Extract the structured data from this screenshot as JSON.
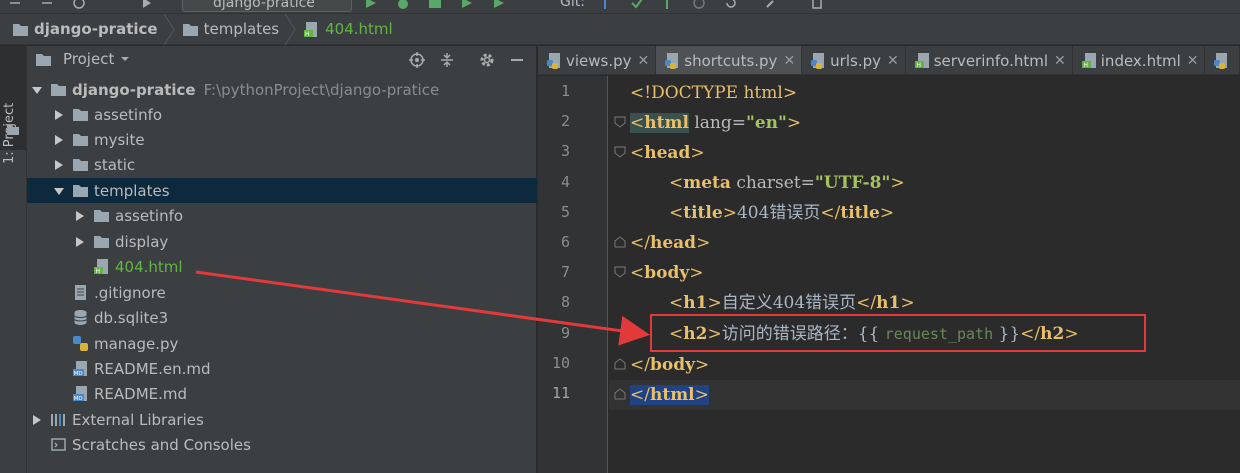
{
  "toolbar": {
    "run_config": "django-pratice",
    "vcs_label": "Git:"
  },
  "breadcrumb": [
    {
      "label": "django-pratice",
      "bold": true
    },
    {
      "label": "templates",
      "bold": false
    },
    {
      "label": "404.html",
      "bold": false
    }
  ],
  "tool_window": {
    "label": "1: Project"
  },
  "project_panel": {
    "title": "Project",
    "tree": [
      {
        "label": "django-pratice",
        "path": "F:\\pythonProject\\django-pratice",
        "depth": 0,
        "arrow": "down",
        "icon": "folder",
        "bold": true
      },
      {
        "label": "assetinfo",
        "depth": 1,
        "arrow": "right",
        "icon": "folder"
      },
      {
        "label": "mysite",
        "depth": 1,
        "arrow": "right",
        "icon": "folder"
      },
      {
        "label": "static",
        "depth": 1,
        "arrow": "right",
        "icon": "folder"
      },
      {
        "label": "templates",
        "depth": 1,
        "arrow": "down",
        "icon": "folder",
        "selected": true
      },
      {
        "label": "assetinfo",
        "depth": 2,
        "arrow": "right",
        "icon": "folder"
      },
      {
        "label": "display",
        "depth": 2,
        "arrow": "right",
        "icon": "folder"
      },
      {
        "label": "404.html",
        "depth": 2,
        "arrow": "none",
        "icon": "html",
        "green": true
      },
      {
        "label": ".gitignore",
        "depth": 1,
        "arrow": "none",
        "icon": "text"
      },
      {
        "label": "db.sqlite3",
        "depth": 1,
        "arrow": "none",
        "icon": "db"
      },
      {
        "label": "manage.py",
        "depth": 1,
        "arrow": "none",
        "icon": "python"
      },
      {
        "label": "README.en.md",
        "depth": 1,
        "arrow": "none",
        "icon": "md"
      },
      {
        "label": "README.md",
        "depth": 1,
        "arrow": "none",
        "icon": "md"
      },
      {
        "label": "External Libraries",
        "depth": 0,
        "arrow": "right",
        "icon": "libs"
      },
      {
        "label": "Scratches and Consoles",
        "depth": 0,
        "arrow": "none",
        "icon": "scratch"
      }
    ]
  },
  "editor": {
    "tabs": [
      {
        "label": "views.py",
        "icon": "python"
      },
      {
        "label": "shortcuts.py",
        "icon": "python",
        "active": true
      },
      {
        "label": "urls.py",
        "icon": "python"
      },
      {
        "label": "serverinfo.html",
        "icon": "html"
      },
      {
        "label": "index.html",
        "icon": "html"
      }
    ],
    "lines": [
      "1",
      "2",
      "3",
      "4",
      "5",
      "6",
      "7",
      "8",
      "9",
      "10",
      "11"
    ],
    "code": {
      "l1": {
        "open": "<!DOCTYPE ",
        "name": "html",
        "close": ">"
      },
      "l2": {
        "open": "<",
        "name": "html",
        "attr": " lang=",
        "val": "\"en\"",
        "close": ">"
      },
      "l3": {
        "open": "<",
        "name": "head",
        "close": ">"
      },
      "l4": {
        "open": "<",
        "name": "meta",
        "attr": " charset=",
        "val": "\"UTF-8\"",
        "close": ">"
      },
      "l5": {
        "open": "<",
        "name": "title",
        "close": ">",
        "text": "404错误页",
        "end_open": "</",
        "end_close": ">"
      },
      "l6": {
        "open": "</",
        "name": "head",
        "close": ">"
      },
      "l7": {
        "open": "<",
        "name": "body",
        "close": ">"
      },
      "l8": {
        "open": "<",
        "name": "h1",
        "close": ">",
        "text": "自定义404错误页",
        "end_open": "</",
        "end_close": ">"
      },
      "l9": {
        "open": "<",
        "name": "h2",
        "close": ">",
        "text": "访问的错误路径：",
        "tmpl_open": "{{ ",
        "var": "request_path",
        "tmpl_close": " }}",
        "end_open": "</",
        "end_close": ">"
      },
      "l10": {
        "open": "</",
        "name": "body",
        "close": ">"
      },
      "l11": {
        "open": "</",
        "name": "html",
        "close": ">"
      }
    }
  },
  "colors": {
    "annotation": "#e23a3a",
    "tag": "#e8bf6a",
    "attr_value": "#a5c261",
    "selection": "#214283",
    "tree_selection": "#0d293e"
  }
}
